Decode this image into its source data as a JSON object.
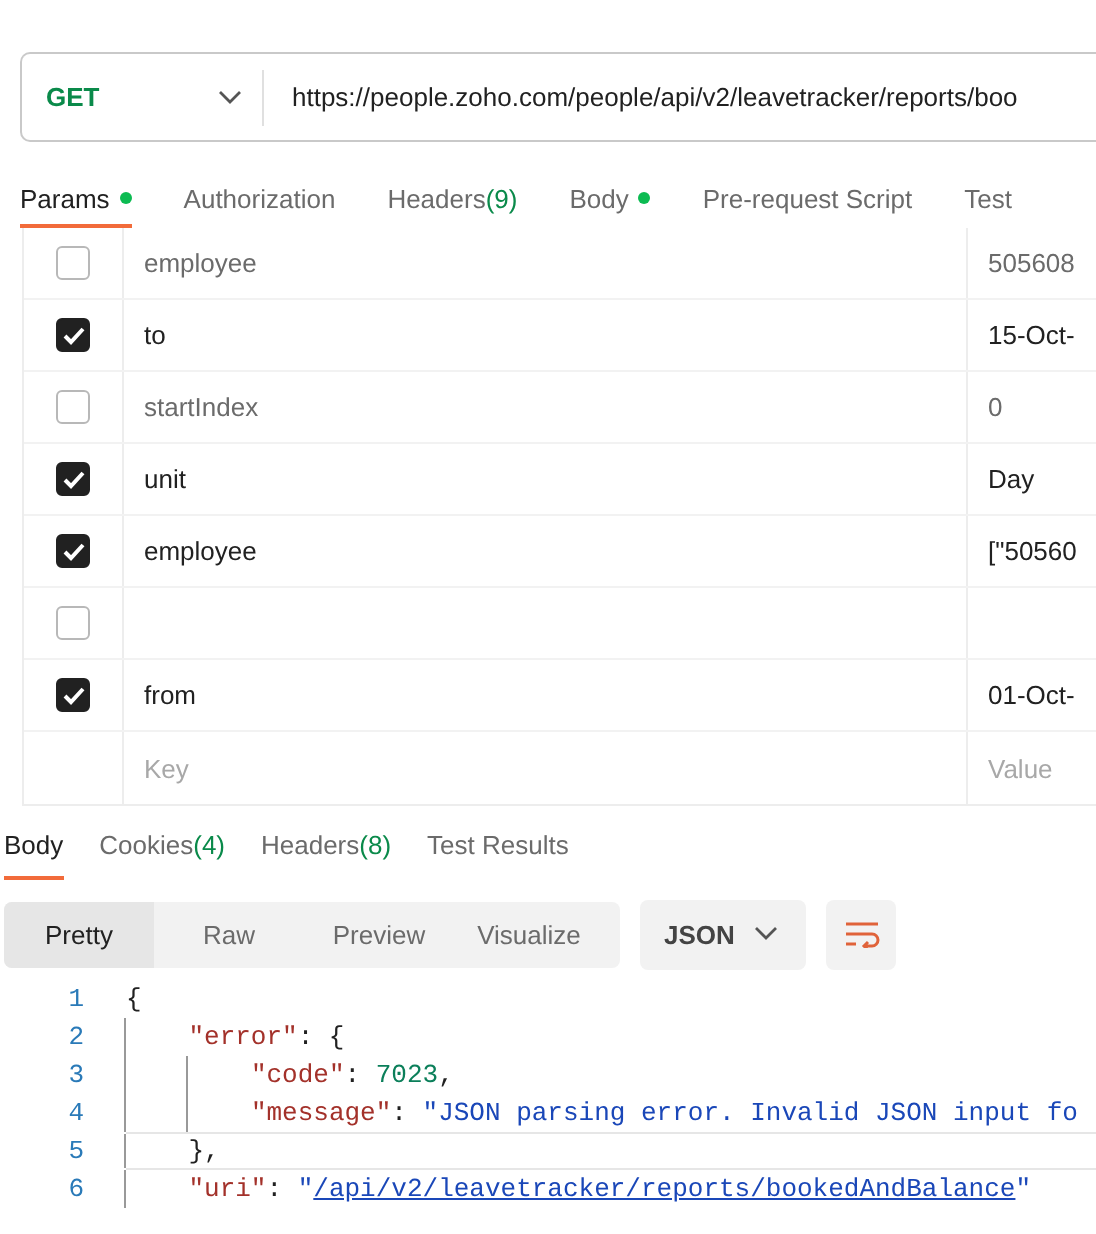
{
  "request": {
    "method": "GET",
    "url": "https://people.zoho.com/people/api/v2/leavetracker/reports/boo"
  },
  "request_tabs": [
    {
      "label": "Params",
      "dot": true,
      "selected": true
    },
    {
      "label": "Authorization",
      "dot": false,
      "selected": false
    },
    {
      "label": "Headers",
      "count": "(9)",
      "dot": false,
      "selected": false
    },
    {
      "label": "Body",
      "dot": true,
      "selected": false
    },
    {
      "label": "Pre-request Script",
      "dot": false,
      "selected": false
    },
    {
      "label": "Test",
      "dot": false,
      "selected": false
    }
  ],
  "params": {
    "rows": [
      {
        "checked": false,
        "key": "employee",
        "value": "505608"
      },
      {
        "checked": true,
        "key": "to",
        "value": "15-Oct-"
      },
      {
        "checked": false,
        "key": "startIndex",
        "value": "0"
      },
      {
        "checked": true,
        "key": "unit",
        "value": "Day"
      },
      {
        "checked": true,
        "key": "employee",
        "value": "[\"50560"
      },
      {
        "checked": false
      },
      {
        "checked": true,
        "key": "from",
        "value": "01-Oct-"
      }
    ],
    "key_placeholder": "Key",
    "value_placeholder": "Value"
  },
  "response_tabs": [
    {
      "label": "Body",
      "selected": true
    },
    {
      "label": "Cookies",
      "count": "(4)",
      "selected": false
    },
    {
      "label": "Headers",
      "count": "(8)",
      "selected": false
    },
    {
      "label": "Test Results",
      "selected": false
    }
  ],
  "view_modes": [
    {
      "label": "Pretty",
      "selected": true
    },
    {
      "label": "Raw",
      "selected": false
    },
    {
      "label": "Preview",
      "selected": false
    },
    {
      "label": "Visualize",
      "selected": false
    }
  ],
  "format": "JSON",
  "code_lines": [
    {
      "number": "1",
      "current": false,
      "tokens": [
        {
          "kind": "punct",
          "text": "{"
        }
      ]
    },
    {
      "number": "2",
      "current": false,
      "tokens": [
        {
          "kind": "key",
          "text": "    \"error\""
        },
        {
          "kind": "punct",
          "text": ": {"
        }
      ]
    },
    {
      "number": "3",
      "current": false,
      "tokens": [
        {
          "kind": "key",
          "text": "        \"code\""
        },
        {
          "kind": "punct",
          "text": ": "
        },
        {
          "kind": "number",
          "text": "7023"
        },
        {
          "kind": "punct",
          "text": ","
        }
      ]
    },
    {
      "number": "4",
      "current": false,
      "tokens": [
        {
          "kind": "key",
          "text": "        \"message\""
        },
        {
          "kind": "punct",
          "text": ": "
        },
        {
          "kind": "string",
          "text": "\"JSON parsing error. Invalid JSON input fo"
        }
      ]
    },
    {
      "number": "5",
      "current": true,
      "tokens": [
        {
          "kind": "punct",
          "text": "    },"
        }
      ]
    },
    {
      "number": "6",
      "current": false,
      "tokens": [
        {
          "kind": "key",
          "text": "    \"uri\""
        },
        {
          "kind": "punct",
          "text": ": "
        },
        {
          "kind": "string",
          "text": "\""
        },
        {
          "kind": "link",
          "text": "/api/v2/leavetracker/reports/bookedAndBalance"
        },
        {
          "kind": "string",
          "text": "\""
        }
      ]
    }
  ]
}
